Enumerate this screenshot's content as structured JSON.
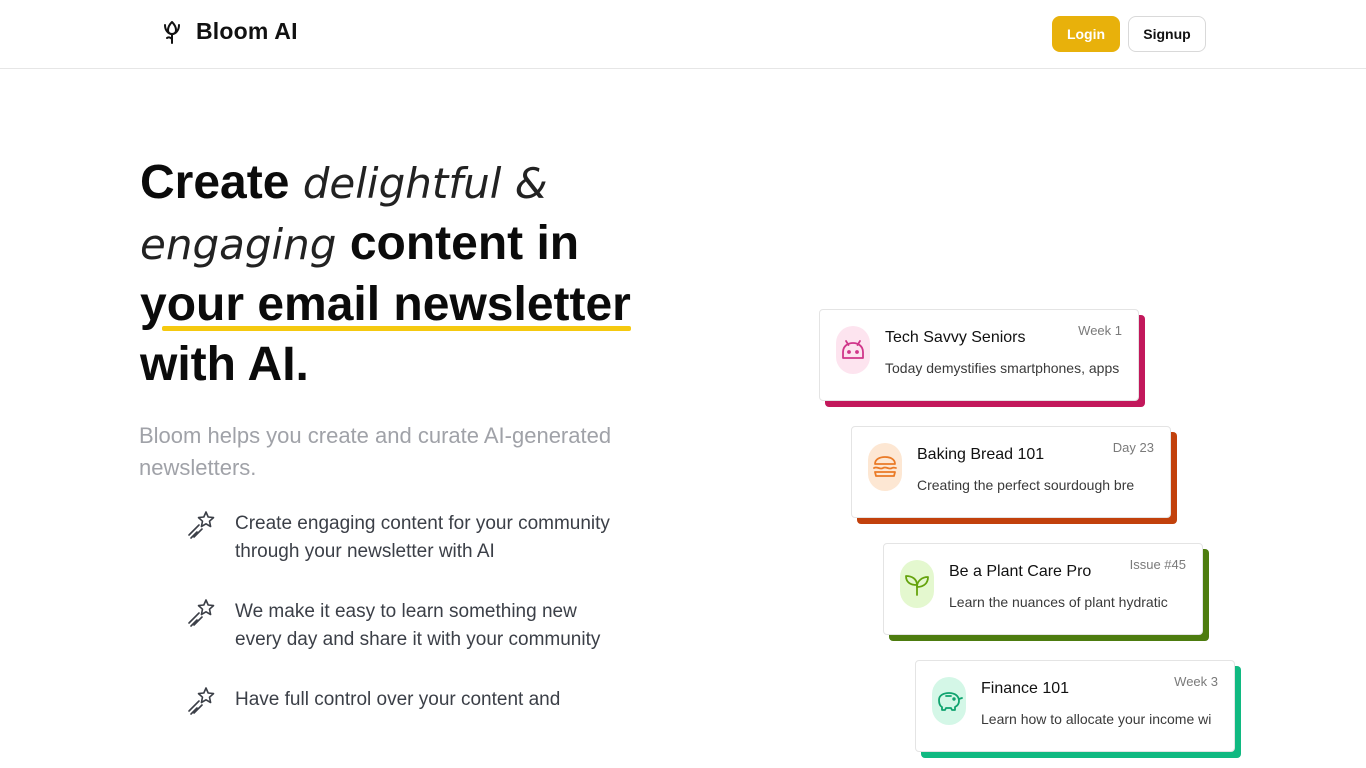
{
  "header": {
    "brand_name": "Bloom AI",
    "brand_icon": "tulip-icon",
    "login_label": "Login",
    "signup_label": "Signup"
  },
  "hero": {
    "headline": {
      "w1": "Create",
      "w2": "delightful &",
      "w3": "engaging",
      "w4": "content in",
      "w5": "your email newsletter",
      "w6": "with AI."
    },
    "subtitle": "Bloom helps you create and curate AI-generated newsletters."
  },
  "features": [
    {
      "icon": "sparkle-star-icon",
      "text": "Create engaging content for your community through your newsletter with AI"
    },
    {
      "icon": "sparkle-star-icon",
      "text": "We make it easy to learn something new every day and share it with your community"
    },
    {
      "icon": "sparkle-star-icon",
      "text": "Have full control over your content and"
    }
  ],
  "cards": [
    {
      "title": "Tech Savvy Seniors",
      "tag": "Week 1",
      "desc": "Today demystifies smartphones, apps",
      "icon": "robot-icon",
      "accent": "#c2185b",
      "icon_bg": "#fde4ef",
      "icon_color": "#d0368a"
    },
    {
      "title": "Baking Bread 101",
      "tag": "Day 23",
      "desc": "Creating the perfect sourdough bre",
      "icon": "burger-icon",
      "accent": "#c2410c",
      "icon_bg": "#fde7d3",
      "icon_color": "#ea7a26"
    },
    {
      "title": "Be a Plant Care Pro",
      "tag": "Issue #45",
      "desc": "Learn the nuances of plant hydratic",
      "icon": "leaf-icon",
      "accent": "#4d7c0f",
      "icon_bg": "#e4f8cf",
      "icon_color": "#65a30d"
    },
    {
      "title": "Finance 101",
      "tag": "Week 3",
      "desc": "Learn how to allocate your income wi",
      "icon": "piggy-bank-icon",
      "accent": "#10b981",
      "icon_bg": "#d4f7e7",
      "icon_color": "#10a36f"
    }
  ],
  "colors": {
    "brand_yellow": "#e8b10b",
    "underline_yellow": "#f5c90f",
    "subtitle_gray": "#a0a2a8"
  }
}
